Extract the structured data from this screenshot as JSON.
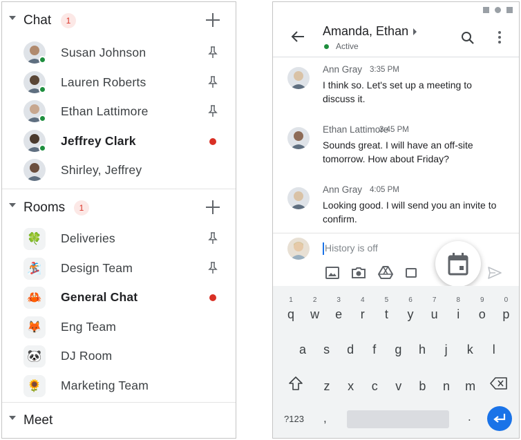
{
  "chat_section": {
    "title": "Chat",
    "count": "1",
    "items": [
      {
        "name": "Susan Johnson",
        "bold": false,
        "online": true,
        "pinned": true,
        "unread": false,
        "avatar_color": "#b08a6e"
      },
      {
        "name": "Lauren Roberts",
        "bold": false,
        "online": true,
        "pinned": true,
        "unread": false,
        "avatar_color": "#5a4636"
      },
      {
        "name": "Ethan Lattimore",
        "bold": false,
        "online": true,
        "pinned": true,
        "unread": false,
        "avatar_color": "#c7a78f"
      },
      {
        "name": "Jeffrey Clark",
        "bold": true,
        "online": true,
        "pinned": false,
        "unread": true,
        "avatar_color": "#4a3a2e"
      },
      {
        "name": "Shirley, Jeffrey",
        "bold": false,
        "online": false,
        "pinned": false,
        "unread": false,
        "avatar_color": "#6b4f3f"
      }
    ]
  },
  "rooms_section": {
    "title": "Rooms",
    "count": "1",
    "items": [
      {
        "name": "Deliveries",
        "emoji": "🍀",
        "bold": false,
        "pinned": true,
        "unread": false
      },
      {
        "name": "Design Team",
        "emoji": "🏂",
        "bold": false,
        "pinned": true,
        "unread": false
      },
      {
        "name": "General Chat",
        "emoji": "🦀",
        "bold": true,
        "pinned": false,
        "unread": true
      },
      {
        "name": "Eng Team",
        "emoji": "🦊",
        "bold": false,
        "pinned": false,
        "unread": false
      },
      {
        "name": "DJ Room",
        "emoji": "🐼",
        "bold": false,
        "pinned": false,
        "unread": false
      },
      {
        "name": "Marketing Team",
        "emoji": "🌻",
        "bold": false,
        "pinned": false,
        "unread": false
      }
    ]
  },
  "meet_section": {
    "title": "Meet"
  },
  "conversation": {
    "title": "Amanda, Ethan",
    "status": "Active",
    "messages": [
      {
        "sender": "Ann Gray",
        "time": "3:35 PM",
        "text": "I think so. Let's set up a meeting to discuss it.",
        "avatar_color": "#d9c2a6"
      },
      {
        "sender": "Ethan Lattimore",
        "time": "3:45 PM",
        "text": "Sounds great. I will have an off-site tomorrow. How about Friday?",
        "avatar_color": "#8d6b57"
      },
      {
        "sender": "Ann Gray",
        "time": "4:05 PM",
        "text": "Looking good. I will send you an invite to confirm.",
        "avatar_color": "#d9c2a6"
      }
    ],
    "compose_placeholder": "History is off",
    "compose_tools": [
      "image-icon",
      "camera-icon",
      "drive-icon",
      "video-icon",
      "calendar-icon"
    ]
  },
  "keyboard": {
    "row1": [
      "q",
      "w",
      "e",
      "r",
      "t",
      "y",
      "u",
      "i",
      "o",
      "p"
    ],
    "row1_hints": [
      "1",
      "2",
      "3",
      "4",
      "5",
      "6",
      "7",
      "8",
      "9",
      "0"
    ],
    "row2": [
      "a",
      "s",
      "d",
      "f",
      "g",
      "h",
      "j",
      "k",
      "l"
    ],
    "row3": [
      "z",
      "x",
      "c",
      "v",
      "b",
      "n",
      "m"
    ],
    "symbols_label": "?123",
    "comma": ",",
    "period": "."
  },
  "colors": {
    "accent": "#1a73e8",
    "online": "#1e8e3e",
    "unread": "#d93025",
    "badge_bg": "#fce8e6"
  }
}
